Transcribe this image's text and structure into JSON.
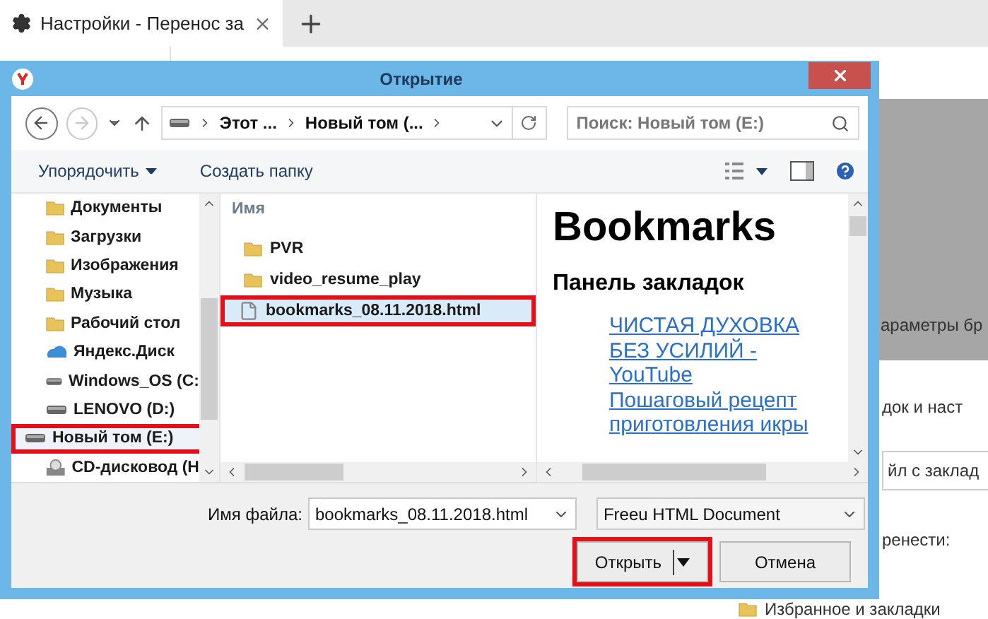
{
  "browser_tab": {
    "title": "Настройки - Перенос за"
  },
  "background": {
    "texts": [
      "араметры бр",
      "док и наст",
      "йл с заклад",
      "ренести:"
    ],
    "bottom_row": "Избранное и закладки"
  },
  "dialog": {
    "title": "Открытие",
    "breadcrumb": [
      "Этот ...",
      "Новый том (..."
    ],
    "search": {
      "placeholder": "Поиск: Новый том (E:)"
    },
    "toolbar": {
      "organize": "Упорядочить",
      "new_folder": "Создать папку"
    },
    "nav_items": [
      {
        "label": "Документы",
        "kind": "folder",
        "selected": false,
        "highlighted": false
      },
      {
        "label": "Загрузки",
        "kind": "folder",
        "selected": false,
        "highlighted": false
      },
      {
        "label": "Изображения",
        "kind": "folder",
        "selected": false,
        "highlighted": false
      },
      {
        "label": "Музыка",
        "kind": "folder",
        "selected": false,
        "highlighted": false
      },
      {
        "label": "Рабочий стол",
        "kind": "folder",
        "selected": false,
        "highlighted": false
      },
      {
        "label": "Яндекс.Диск",
        "kind": "cloud",
        "selected": false,
        "highlighted": false
      },
      {
        "label": "Windows_OS (C:",
        "kind": "drive",
        "selected": false,
        "highlighted": false
      },
      {
        "label": "LENOVO (D:)",
        "kind": "drive",
        "selected": false,
        "highlighted": false
      },
      {
        "label": "Новый том (E:)",
        "kind": "drive",
        "selected": true,
        "highlighted": true
      },
      {
        "label": "CD-дисковод (H",
        "kind": "cd",
        "selected": false,
        "highlighted": false
      }
    ],
    "column_header": "Имя",
    "files": [
      {
        "name": "PVR",
        "kind": "folder",
        "selected": false,
        "highlighted": false
      },
      {
        "name": "video_resume_play",
        "kind": "folder",
        "selected": false,
        "highlighted": false
      },
      {
        "name": "bookmarks_08.11.2018.html",
        "kind": "file",
        "selected": true,
        "highlighted": true
      }
    ],
    "preview": {
      "heading": "Bookmarks",
      "subheading": "Панель закладок",
      "links": [
        "ЧИСТАЯ ДУХОВКА БЕЗ УСИЛИЙ - YouTube",
        "Пошаговый рецепт приготовления икры"
      ]
    },
    "filename_label": "Имя файла:",
    "filename_value": "bookmarks_08.11.2018.html",
    "filetype": "Freeu HTML Document",
    "buttons": [
      {
        "label": "Открыть",
        "kind": "split",
        "highlighted": true
      },
      {
        "label": "Отмена",
        "kind": "plain",
        "highlighted": false
      }
    ]
  }
}
